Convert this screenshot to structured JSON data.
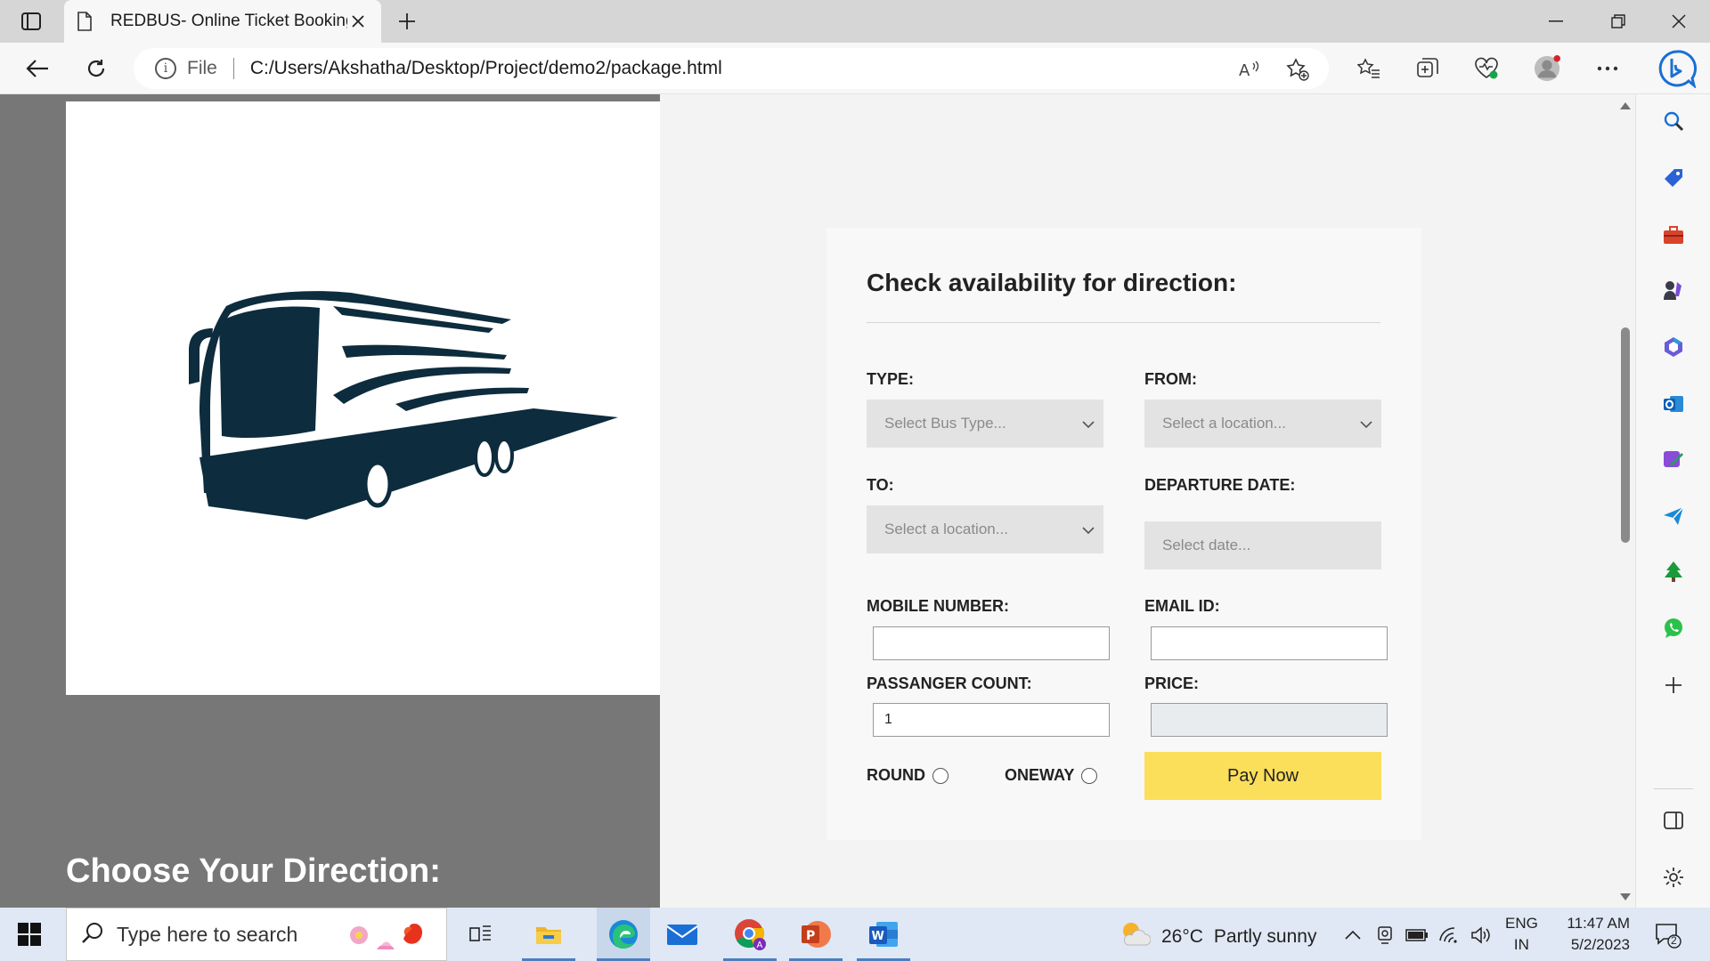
{
  "browser": {
    "tab_title": "REDBUS- Online Ticket Booking",
    "address_label": "File",
    "url": "C:/Users/Akshatha/Desktop/Project/demo2/package.html"
  },
  "page": {
    "choose_heading": "Choose Your Direction:",
    "form": {
      "title": "Check availability for direction:",
      "type_label": "TYPE:",
      "type_placeholder": "Select Bus Type...",
      "from_label": "FROM:",
      "from_placeholder": "Select a location...",
      "to_label": "TO:",
      "to_placeholder": "Select a location...",
      "date_label": "DEPARTURE DATE:",
      "date_placeholder": "Select date...",
      "mobile_label": "MOBILE NUMBER:",
      "mobile_value": "",
      "email_label": "EMAIL ID:",
      "email_value": "",
      "count_label": "PASSANGER COUNT:",
      "count_value": "1",
      "price_label": "PRICE:",
      "price_value": "",
      "round_label": "ROUND",
      "oneway_label": "ONEWAY",
      "pay_button": "Pay Now"
    }
  },
  "taskbar": {
    "search_placeholder": "Type here to search",
    "temperature": "26°C",
    "weather_text": "Partly sunny",
    "lang_top": "ENG",
    "lang_bottom": "IN",
    "time": "11:47 AM",
    "date": "5/2/2023",
    "notification_count": "2"
  },
  "colors": {
    "pay_button": "#fbdf5a",
    "left_panel": "#777777",
    "bus": "#0d2c3d"
  }
}
